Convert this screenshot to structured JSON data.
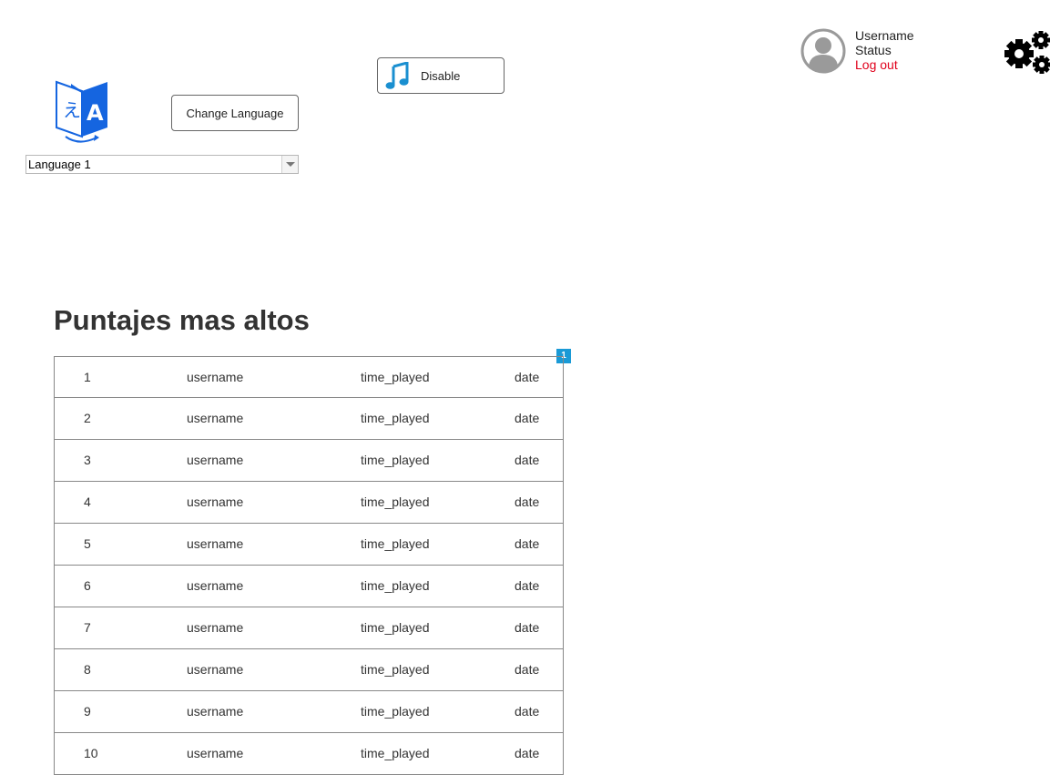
{
  "language": {
    "change_label": "Change Language",
    "selected": "Language 1"
  },
  "music": {
    "toggle_label": "Disable"
  },
  "user": {
    "name": "Username",
    "status": "Status",
    "logout_label": "Log out"
  },
  "scores": {
    "title": "Puntajes mas altos",
    "page_badge": "1",
    "rows": [
      {
        "rank": "1",
        "user": "username",
        "time": "time_played",
        "date": "date"
      },
      {
        "rank": "2",
        "user": "username",
        "time": "time_played",
        "date": "date"
      },
      {
        "rank": "3",
        "user": "username",
        "time": "time_played",
        "date": "date"
      },
      {
        "rank": "4",
        "user": "username",
        "time": "time_played",
        "date": "date"
      },
      {
        "rank": "5",
        "user": "username",
        "time": "time_played",
        "date": "date"
      },
      {
        "rank": "6",
        "user": "username",
        "time": "time_played",
        "date": "date"
      },
      {
        "rank": "7",
        "user": "username",
        "time": "time_played",
        "date": "date"
      },
      {
        "rank": "8",
        "user": "username",
        "time": "time_played",
        "date": "date"
      },
      {
        "rank": "9",
        "user": "username",
        "time": "time_played",
        "date": "date"
      },
      {
        "rank": "10",
        "user": "username",
        "time": "time_played",
        "date": "date"
      }
    ]
  },
  "icons": {
    "logo": "translate-icon",
    "music": "music-note-icon",
    "avatar": "user-avatar-icon",
    "settings": "gears-icon"
  },
  "colors": {
    "logo_blue": "#1565e0",
    "music_blue": "#1a8fd0",
    "logout_red": "#e0001b",
    "badge_blue": "#1a9ad6"
  }
}
